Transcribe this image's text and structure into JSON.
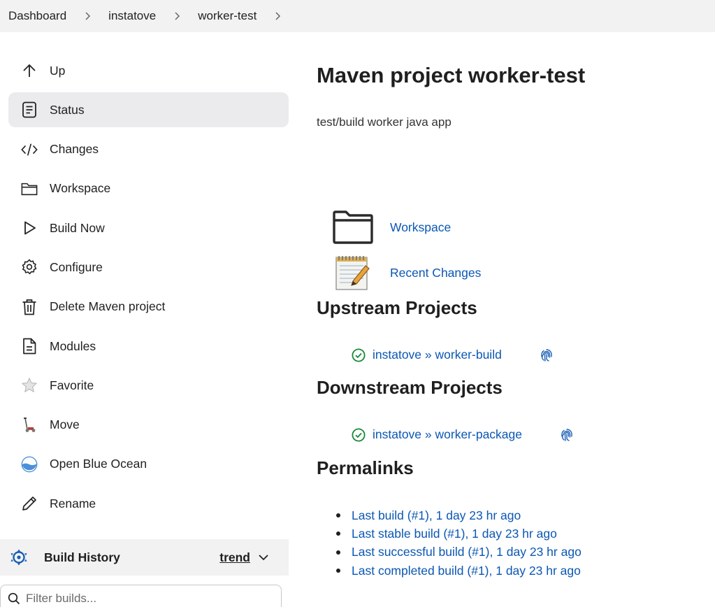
{
  "breadcrumb": [
    "Dashboard",
    "instatove",
    "worker-test"
  ],
  "sidebar": {
    "items": [
      {
        "label": "Up",
        "icon": "arrow-up-icon"
      },
      {
        "label": "Status",
        "icon": "document-icon"
      },
      {
        "label": "Changes",
        "icon": "code-icon"
      },
      {
        "label": "Workspace",
        "icon": "folder-icon"
      },
      {
        "label": "Build Now",
        "icon": "play-icon"
      },
      {
        "label": "Configure",
        "icon": "gear-icon"
      },
      {
        "label": "Delete Maven project",
        "icon": "trash-icon"
      },
      {
        "label": "Modules",
        "icon": "file-icon"
      },
      {
        "label": "Favorite",
        "icon": "star-icon"
      },
      {
        "label": "Move",
        "icon": "scooter-icon"
      },
      {
        "label": "Open Blue Ocean",
        "icon": "blue-ocean-icon"
      },
      {
        "label": "Rename",
        "icon": "pencil-icon"
      }
    ],
    "active_item": "Status"
  },
  "build_history": {
    "title": "Build History",
    "trend_label": "trend",
    "filter_placeholder": "Filter builds..."
  },
  "main": {
    "title": "Maven project worker-test",
    "description": "test/build worker java app",
    "workspace_link": "Workspace",
    "recent_changes_link": "Recent Changes",
    "upstream_title": "Upstream Projects",
    "upstream_project": "instatove » worker-build",
    "downstream_title": "Downstream Projects",
    "downstream_project": "instatove » worker-package",
    "permalinks_title": "Permalinks",
    "permalinks": [
      "Last build (#1), 1 day 23 hr ago",
      "Last stable build (#1), 1 day 23 hr ago",
      "Last successful build (#1), 1 day 23 hr ago",
      "Last completed build (#1), 1 day 23 hr ago"
    ]
  },
  "colors": {
    "link": "#0b57b4",
    "success": "#138a36",
    "active_bg": "#ebebed",
    "blue_ocean": "#4a90d9"
  }
}
